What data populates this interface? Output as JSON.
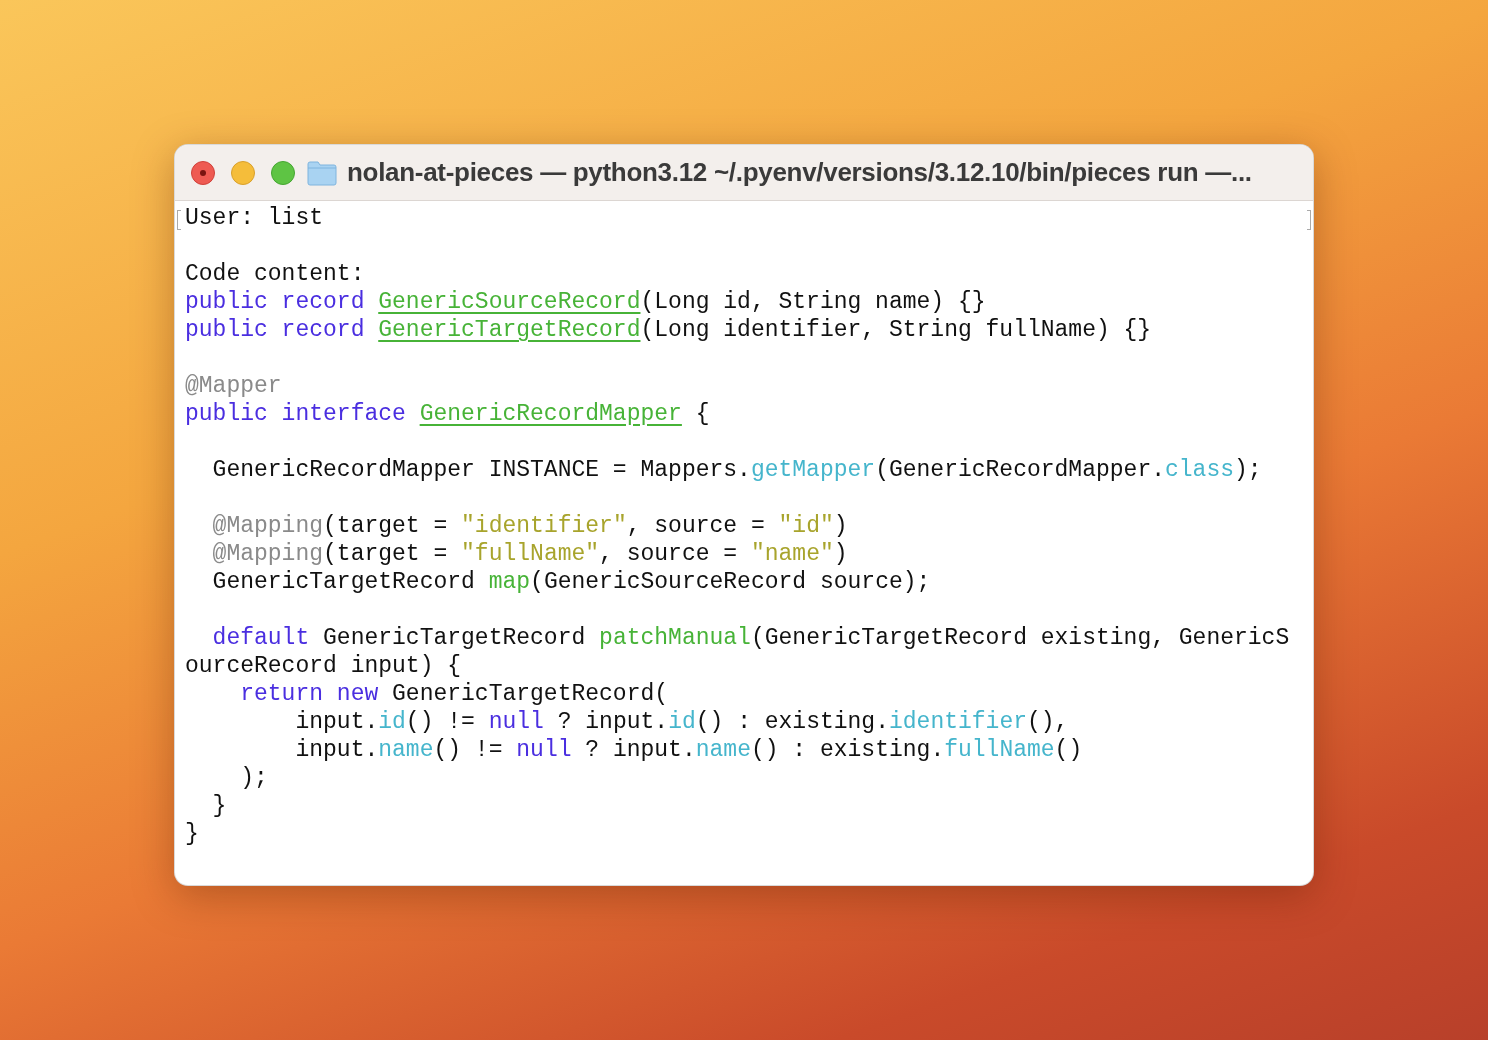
{
  "window": {
    "title": "nolan-at-pieces — python3.12 ~/.pyenv/versions/3.12.10/bin/pieces run —..."
  },
  "terminal": {
    "lines": [
      {
        "kind": "code",
        "marked": true,
        "tokens": [
          {
            "kind": "text",
            "text": "User: list"
          }
        ]
      },
      {
        "kind": "blank"
      },
      {
        "kind": "code",
        "tokens": [
          {
            "kind": "text",
            "text": "Code content:"
          }
        ]
      },
      {
        "kind": "code",
        "tokens": [
          {
            "kind": "keyword",
            "text": "public record "
          },
          {
            "kind": "type",
            "text": "GenericSourceRecord"
          },
          {
            "kind": "text",
            "text": "(Long id, String name) {}"
          }
        ]
      },
      {
        "kind": "code",
        "tokens": [
          {
            "kind": "keyword",
            "text": "public record "
          },
          {
            "kind": "type",
            "text": "GenericTargetRecord"
          },
          {
            "kind": "text",
            "text": "(Long identifier, String fullName) {}"
          }
        ]
      },
      {
        "kind": "blank"
      },
      {
        "kind": "code",
        "tokens": [
          {
            "kind": "annotation",
            "text": "@Mapper"
          }
        ]
      },
      {
        "kind": "code",
        "tokens": [
          {
            "kind": "keyword",
            "text": "public interface "
          },
          {
            "kind": "type",
            "text": "GenericRecordMapper"
          },
          {
            "kind": "text",
            "text": " {"
          }
        ]
      },
      {
        "kind": "blank"
      },
      {
        "kind": "code",
        "tokens": [
          {
            "kind": "text",
            "text": "  GenericRecordMapper INSTANCE = Mappers."
          },
          {
            "kind": "method",
            "text": "getMapper"
          },
          {
            "kind": "text",
            "text": "(GenericRecordMapper."
          },
          {
            "kind": "method",
            "text": "class"
          },
          {
            "kind": "text",
            "text": ");"
          }
        ]
      },
      {
        "kind": "blank"
      },
      {
        "kind": "code",
        "tokens": [
          {
            "kind": "annotation",
            "text": "  @Mapping"
          },
          {
            "kind": "text",
            "text": "(target = "
          },
          {
            "kind": "string",
            "text": "\"identifier\""
          },
          {
            "kind": "text",
            "text": ", source = "
          },
          {
            "kind": "string",
            "text": "\"id\""
          },
          {
            "kind": "text",
            "text": ")"
          }
        ]
      },
      {
        "kind": "code",
        "tokens": [
          {
            "kind": "annotation",
            "text": "  @Mapping"
          },
          {
            "kind": "text",
            "text": "(target = "
          },
          {
            "kind": "string",
            "text": "\"fullName\""
          },
          {
            "kind": "text",
            "text": ", source = "
          },
          {
            "kind": "string",
            "text": "\"name\""
          },
          {
            "kind": "text",
            "text": ")"
          }
        ]
      },
      {
        "kind": "code",
        "tokens": [
          {
            "kind": "text",
            "text": "  GenericTargetRecord "
          },
          {
            "kind": "decl",
            "text": "map"
          },
          {
            "kind": "text",
            "text": "(GenericSourceRecord source);"
          }
        ]
      },
      {
        "kind": "blank"
      },
      {
        "kind": "code",
        "tokens": [
          {
            "kind": "keyword",
            "text": "  default"
          },
          {
            "kind": "text",
            "text": " GenericTargetRecord "
          },
          {
            "kind": "decl",
            "text": "patchManual"
          },
          {
            "kind": "text",
            "text": "(GenericTargetRecord existing, GenericS"
          }
        ]
      },
      {
        "kind": "code",
        "tokens": [
          {
            "kind": "text",
            "text": "ourceRecord input) {"
          }
        ]
      },
      {
        "kind": "code",
        "tokens": [
          {
            "kind": "keyword",
            "text": "    return new"
          },
          {
            "kind": "text",
            "text": " GenericTargetRecord("
          }
        ]
      },
      {
        "kind": "code",
        "tokens": [
          {
            "kind": "text",
            "text": "        input."
          },
          {
            "kind": "method",
            "text": "id"
          },
          {
            "kind": "text",
            "text": "() != "
          },
          {
            "kind": "keyword",
            "text": "null"
          },
          {
            "kind": "text",
            "text": " ? input."
          },
          {
            "kind": "method",
            "text": "id"
          },
          {
            "kind": "text",
            "text": "() : existing."
          },
          {
            "kind": "method",
            "text": "identifier"
          },
          {
            "kind": "text",
            "text": "(),"
          }
        ]
      },
      {
        "kind": "code",
        "tokens": [
          {
            "kind": "text",
            "text": "        input."
          },
          {
            "kind": "method",
            "text": "name"
          },
          {
            "kind": "text",
            "text": "() != "
          },
          {
            "kind": "keyword",
            "text": "null"
          },
          {
            "kind": "text",
            "text": " ? input."
          },
          {
            "kind": "method",
            "text": "name"
          },
          {
            "kind": "text",
            "text": "() : existing."
          },
          {
            "kind": "method",
            "text": "fullName"
          },
          {
            "kind": "text",
            "text": "()"
          }
        ]
      },
      {
        "kind": "code",
        "tokens": [
          {
            "kind": "text",
            "text": "    );"
          }
        ]
      },
      {
        "kind": "code",
        "tokens": [
          {
            "kind": "text",
            "text": "  }"
          }
        ]
      },
      {
        "kind": "code",
        "tokens": [
          {
            "kind": "text",
            "text": "}"
          }
        ]
      }
    ]
  }
}
